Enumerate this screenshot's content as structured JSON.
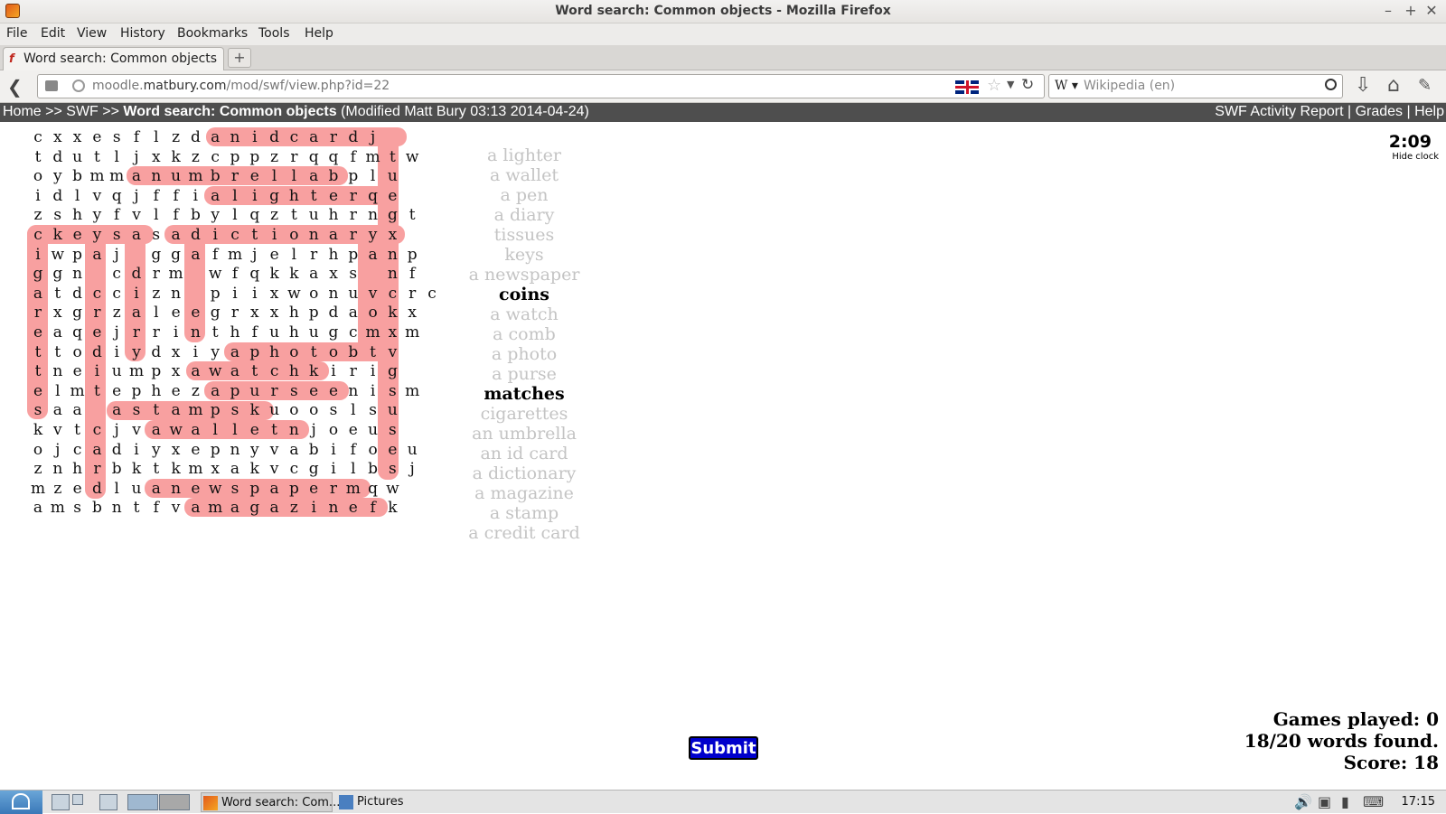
{
  "window": {
    "title": "Word search: Common objects - Mozilla Firefox",
    "min": "–",
    "max": "+",
    "close": "✕"
  },
  "menu": [
    "File",
    "Edit",
    "View",
    "History",
    "Bookmarks",
    "Tools",
    "Help"
  ],
  "tab": {
    "label": "Word search: Common objects",
    "new_tab": "+"
  },
  "url": {
    "prefix": "moodle.",
    "domain": "matbury.com",
    "path": "/mod/swf/view.php?id=22"
  },
  "search": {
    "engine": "W ▾",
    "placeholder": "Wikipedia (en)"
  },
  "breadcrumb": {
    "home": "Home",
    "sep": ">>",
    "swf": "SWF",
    "current": "Word search: Common objects",
    "modified": "(Modified Matt Bury 03:13 2014-04-24)"
  },
  "moodle_right": "SWF Activity Report | Grades | Help",
  "grid": [
    "cxxesflzdanidcardj",
    "tdutljxkzcppzrqqfmtw",
    "oybmmanumbrellabplu",
    "idlvqjffialighterqe",
    "zshyfvlfbylqztuhrngt",
    "ckeysasadictionaryx",
    "iwpaj ggafmjelrhpanp",
    "ggn cdrm wfqkkaxs nf",
    "atdccizn piixwonuvcrc",
    "rxgrzaleegrxxhpdaokx",
    "eaqejrrinthfuhugcmxm",
    "ttodiydxiyaphotobtv",
    "tneiumpxawatchkirig",
    "elmtephezapurseenism",
    "saa astampskuooslsu",
    "kvtcjvawalletnjoeus",
    "ojcadiyxepnyvabifoeu",
    "znhrbktkmxakvcgilbsj",
    "mzedluanewspapermqw",
    "amsbntfvamagazinefk"
  ],
  "words": [
    {
      "text": "a lighter",
      "found": true
    },
    {
      "text": "a wallet",
      "found": true
    },
    {
      "text": "a pen",
      "found": true
    },
    {
      "text": "a diary",
      "found": true
    },
    {
      "text": "tissues",
      "found": true
    },
    {
      "text": "keys",
      "found": true
    },
    {
      "text": "a newspaper",
      "found": true
    },
    {
      "text": "coins",
      "found": false
    },
    {
      "text": "a watch",
      "found": true
    },
    {
      "text": "a comb",
      "found": true
    },
    {
      "text": "a photo",
      "found": true
    },
    {
      "text": "a purse",
      "found": true
    },
    {
      "text": "matches",
      "found": false
    },
    {
      "text": "cigarettes",
      "found": true
    },
    {
      "text": "an umbrella",
      "found": true
    },
    {
      "text": "an id card",
      "found": true
    },
    {
      "text": "a dictionary",
      "found": true
    },
    {
      "text": "a magazine",
      "found": true
    },
    {
      "text": "a stamp",
      "found": true
    },
    {
      "text": "a credit card",
      "found": true
    }
  ],
  "clock": {
    "time": "2:09",
    "hide": "Hide clock"
  },
  "stats": {
    "games": "Games played: 0",
    "found": "18/20 words found.",
    "score": "Score: 18"
  },
  "submit_label": "Submit",
  "taskbar": {
    "task1": "Word search: Com...",
    "task2": "Pictures",
    "clock": "17:15"
  }
}
